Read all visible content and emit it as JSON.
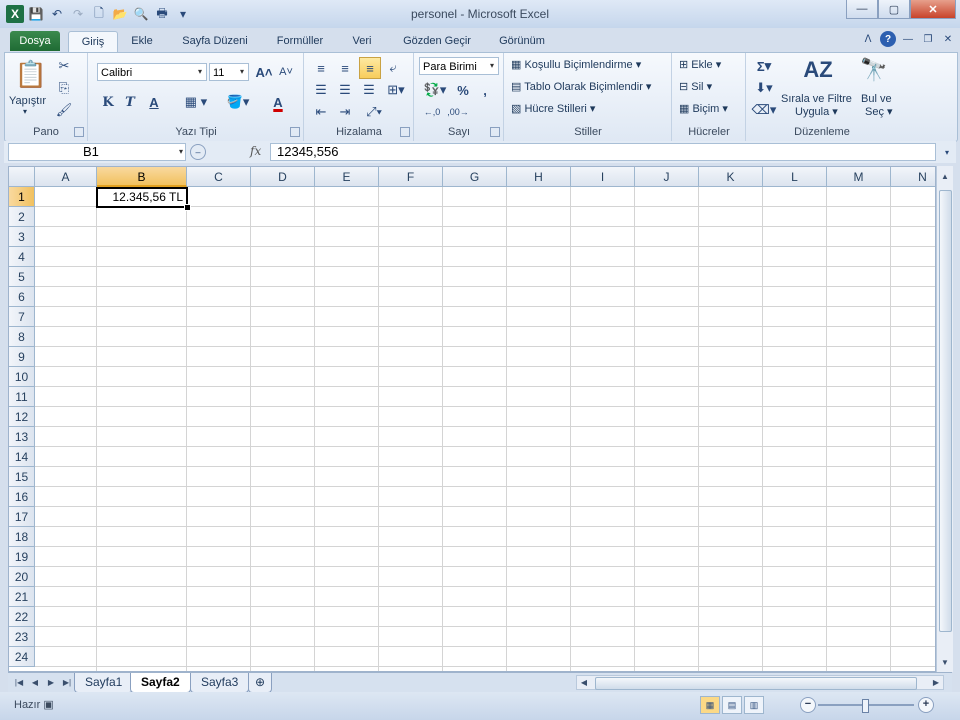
{
  "window": {
    "title": "personel - Microsoft Excel"
  },
  "ribbon_tabs": [
    "Dosya",
    "Giriş",
    "Ekle",
    "Sayfa Düzeni",
    "Formüller",
    "Veri",
    "Gözden Geçir",
    "Görünüm"
  ],
  "groups": {
    "pano": {
      "label": "Pano",
      "paste_label": "Yapıştır"
    },
    "font": {
      "label": "Yazı Tipi",
      "font_name": "Calibri",
      "font_size": "11",
      "bold": "K",
      "italic": "T",
      "underline": "A",
      "font_color": "A"
    },
    "alignment": {
      "label": "Hizalama"
    },
    "number": {
      "label": "Sayı",
      "format": "Para Birimi",
      "percent": "%",
      "comma": ","
    },
    "styles": {
      "label": "Stiller",
      "conditional": "Koşullu Biçimlendirme",
      "table": "Tablo Olarak Biçimlendir",
      "cell_styles": "Hücre Stilleri"
    },
    "cells": {
      "label": "Hücreler",
      "insert": "Ekle",
      "delete": "Sil",
      "format": "Biçim"
    },
    "editing": {
      "label": "Düzenleme",
      "sort_line1": "Sırala ve Filtre",
      "sort_line2": "Uygula",
      "find_line1": "Bul ve",
      "find_line2": "Seç",
      "sum": "Σ"
    }
  },
  "formula_bar": {
    "name_box": "B1",
    "fx": "fx",
    "formula": "12345,556"
  },
  "columns": [
    "A",
    "B",
    "C",
    "D",
    "E",
    "F",
    "G",
    "H",
    "I",
    "J",
    "K",
    "L",
    "M",
    "N"
  ],
  "selected_column": "B",
  "rows": [
    "1",
    "2",
    "3",
    "4",
    "5",
    "6",
    "7",
    "8",
    "9",
    "10",
    "11",
    "12",
    "13",
    "14",
    "15",
    "16",
    "17",
    "18",
    "19",
    "20",
    "21",
    "22",
    "23",
    "24"
  ],
  "selected_row": "1",
  "active_cell": {
    "ref": "B1",
    "display": "12.345,56 TL"
  },
  "sheets": [
    "Sayfa1",
    "Sayfa2",
    "Sayfa3"
  ],
  "active_sheet": "Sayfa2",
  "status": {
    "mode": "Hazır"
  },
  "colors": {
    "file_tab": "#1f6b34",
    "selection": "#f1c15f",
    "grid": "#d4d4d4"
  }
}
